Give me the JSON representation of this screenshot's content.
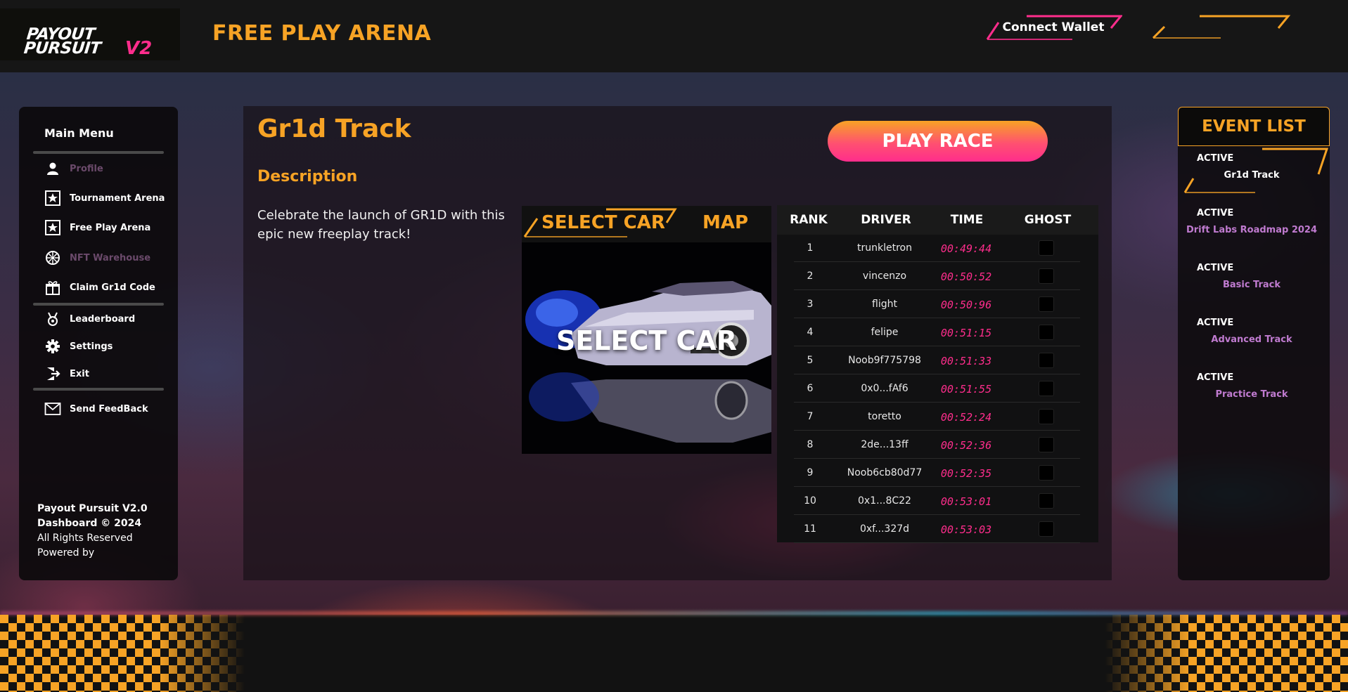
{
  "app": {
    "logo_line1": "PAYOUT",
    "logo_line2": "PURSUIT",
    "logo_version": "V2",
    "page_heading": "FREE PLAY ARENA",
    "connect_wallet_label": "Connect Wallet"
  },
  "colors": {
    "accent_orange": "#f7a325",
    "accent_pink": "#ff2d8c",
    "disabled_text": "#6b4a6b",
    "event_name": "#c07bd0"
  },
  "sidebar": {
    "title": "Main Menu",
    "items": [
      {
        "label": "Profile",
        "icon": "user-icon",
        "disabled": true
      },
      {
        "label": "Tournament Arena",
        "icon": "star-icon",
        "disabled": false
      },
      {
        "label": "Free Play Arena",
        "icon": "star-icon",
        "disabled": false
      },
      {
        "label": "NFT Warehouse",
        "icon": "wheel-icon",
        "disabled": true
      },
      {
        "label": "Claim Gr1d Code",
        "icon": "gift-icon",
        "disabled": false
      },
      {
        "label": "Leaderboard",
        "icon": "medal-icon",
        "disabled": false
      },
      {
        "label": "Settings",
        "icon": "gear-icon",
        "disabled": false
      },
      {
        "label": "Exit",
        "icon": "exit-icon",
        "disabled": false
      },
      {
        "label": "Send FeedBack",
        "icon": "mail-icon",
        "disabled": false
      }
    ],
    "footer": {
      "line1": "Payout Pursuit V2.0",
      "line2": "Dashboard © 2024",
      "line3": "All Rights Reserved",
      "line4": "Powered by"
    }
  },
  "main": {
    "track_title": "Gr1d Track",
    "play_button": "PLAY RACE",
    "description_heading": "Description",
    "description_text": "Celebrate the launch of GR1D with this epic new freeplay track!",
    "car_tabs": {
      "select_car": "SELECT CAR",
      "map": "MAP"
    },
    "car_overlay_label": "SELECT CAR"
  },
  "leaderboard": {
    "columns": {
      "rank": "RANK",
      "driver": "DRIVER",
      "time": "TIME",
      "ghost": "GHOST"
    },
    "rows": [
      {
        "rank": "1",
        "driver": "trunkletron",
        "time": "00:49:44"
      },
      {
        "rank": "2",
        "driver": "vincenzo",
        "time": "00:50:52"
      },
      {
        "rank": "3",
        "driver": "flight",
        "time": "00:50:96"
      },
      {
        "rank": "4",
        "driver": "felipe",
        "time": "00:51:15"
      },
      {
        "rank": "5",
        "driver": "Noob9f775798",
        "time": "00:51:33"
      },
      {
        "rank": "6",
        "driver": "0x0...fAf6",
        "time": "00:51:55"
      },
      {
        "rank": "7",
        "driver": "toretto",
        "time": "00:52:24"
      },
      {
        "rank": "8",
        "driver": "2de...13ff",
        "time": "00:52:36"
      },
      {
        "rank": "9",
        "driver": "Noob6cb80d77",
        "time": "00:52:35"
      },
      {
        "rank": "10",
        "driver": "0x1...8C22",
        "time": "00:53:01"
      },
      {
        "rank": "11",
        "driver": "0xf...327d",
        "time": "00:53:03"
      }
    ]
  },
  "events": {
    "title": "EVENT LIST",
    "items": [
      {
        "status": "ACTIVE",
        "name": "Gr1d Track",
        "current": true
      },
      {
        "status": "ACTIVE",
        "name": "Drift Labs Roadmap 2024",
        "current": false
      },
      {
        "status": "ACTIVE",
        "name": "Basic Track",
        "current": false
      },
      {
        "status": "ACTIVE",
        "name": "Advanced Track",
        "current": false
      },
      {
        "status": "ACTIVE",
        "name": "Practice Track",
        "current": false
      }
    ]
  }
}
